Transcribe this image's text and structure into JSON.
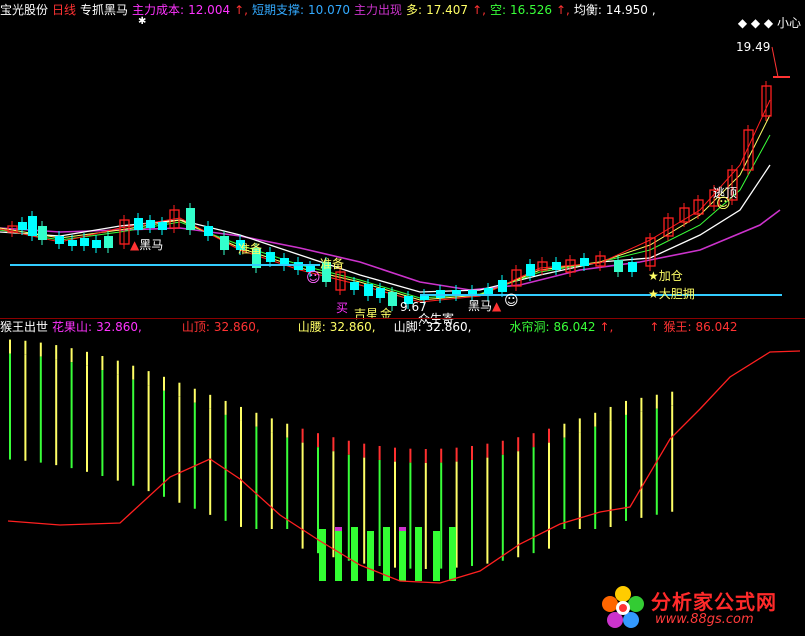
{
  "top_header": {
    "stock_name": "宝光股份",
    "period": "日线",
    "indicator": "专抓黑马",
    "main_cost_label": "主力成本:",
    "main_cost_value": "12.004",
    "short_support_label": "短期支撑:",
    "short_support_value": "10.070",
    "main_exit_label": "主力出现",
    "long_label": "多:",
    "long_value": "17.407",
    "short_label": "空:",
    "short_value": "16.526",
    "balance_label": "均衡:",
    "balance_value": "14.950"
  },
  "top_right": {
    "icons": "◆ ◆ ◆",
    "label": "小心"
  },
  "price_labels": {
    "high": "19.49",
    "low": "9.67"
  },
  "annotations": {
    "heima1": "黑马",
    "zhunbei1": "准备",
    "zhunbei2": "准备",
    "mai": "买",
    "jixing": "吉星",
    "jinchang": "金",
    "heima2": "黑马",
    "jiacang": "★加仓",
    "dadan": "★大胆拥",
    "taoding": "逃顶",
    "qisheng": "众生寄"
  },
  "bottom_header": {
    "title": "猴王出世",
    "huaguoshan_label": "花果山:",
    "huaguoshan_value": "32.860,",
    "shanding_label": "山顶:",
    "shanding_value": "32.860,",
    "shanyao_label": "山腰:",
    "shanyao_value": "32.860,",
    "shanjiao_label": "山脚:",
    "shanjiao_value": "32.860,",
    "shuiliandong_label": "水帘洞:",
    "shuiliandong_value": "86.042",
    "houwang_label": "猴王:",
    "houwang_value": "86.042"
  },
  "watermark": {
    "title": "分析家公式网",
    "url": "www.88gs.com"
  },
  "colors": {
    "up": "#ff2020",
    "down": "#00ffff",
    "green": "#39ff39",
    "magenta": "#cc33cc",
    "yellow": "#ffff66",
    "white": "#ffffff",
    "cyan_line": "#33ccff",
    "label_blue": "#33aaff",
    "label_magenta": "#ff33ff"
  }
}
